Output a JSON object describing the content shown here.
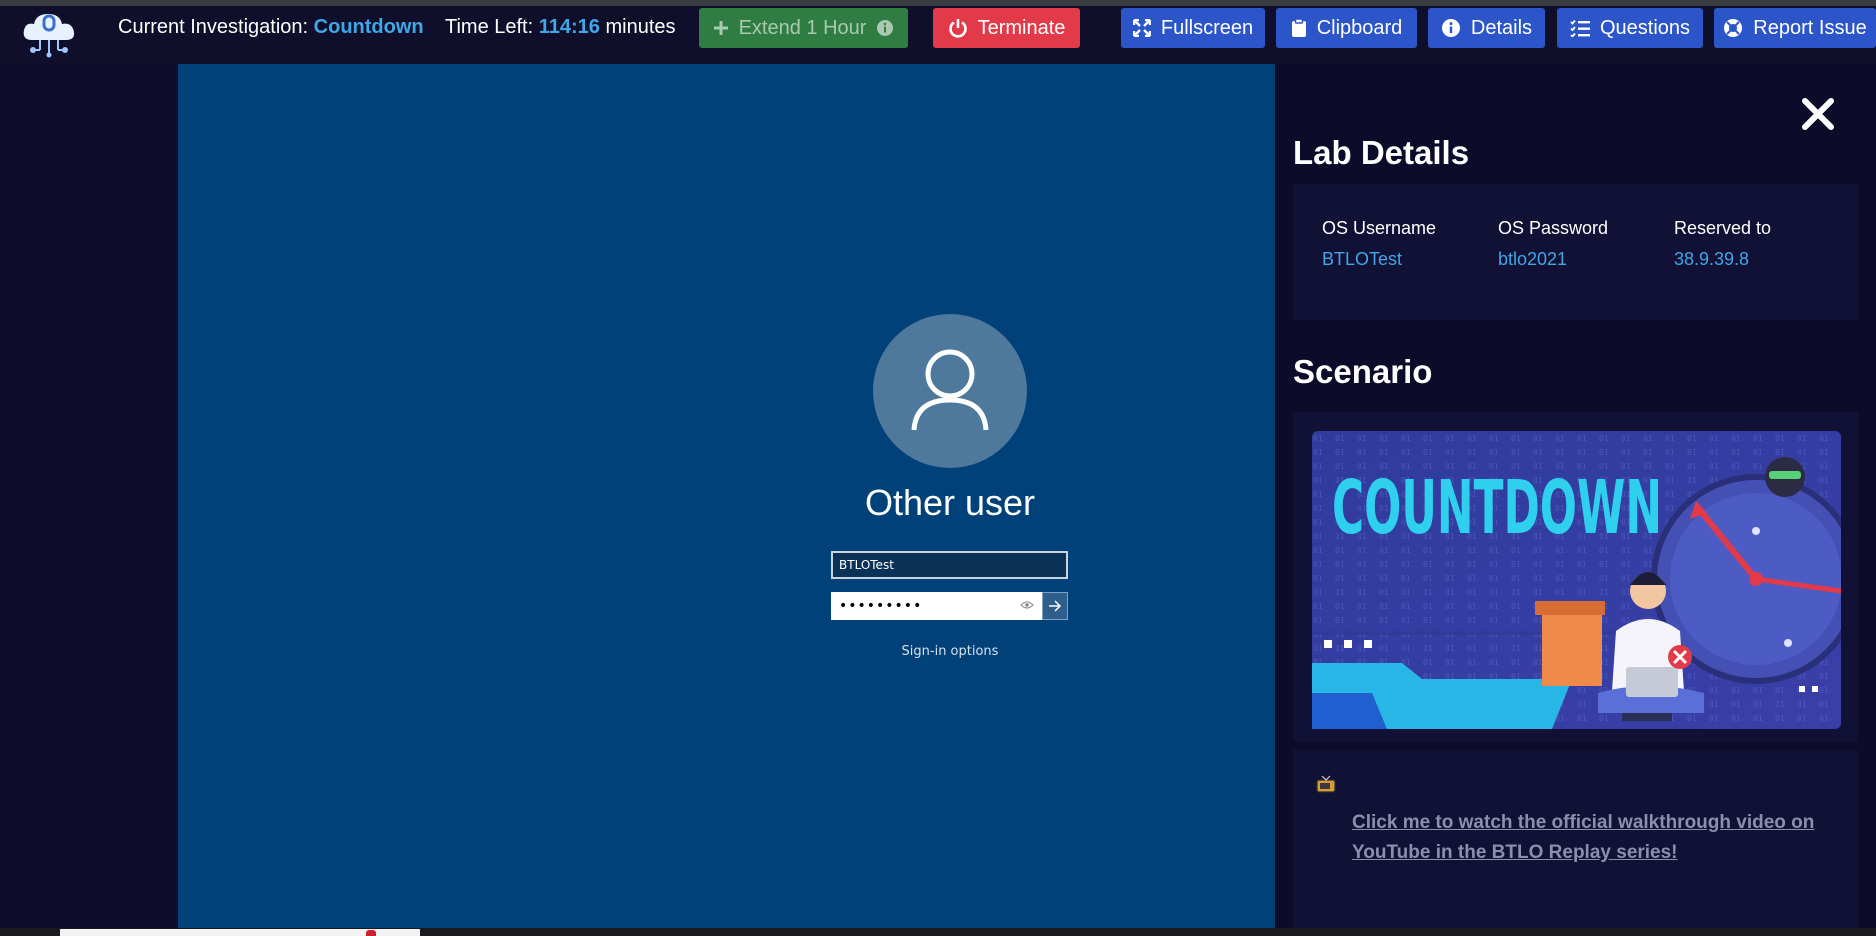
{
  "header": {
    "investigation_label": "Current Investigation:",
    "investigation_name": "Countdown",
    "time_label": "Time Left:",
    "time_value": "114:16",
    "time_unit": "minutes",
    "buttons": {
      "extend": "Extend 1 Hour",
      "terminate": "Terminate",
      "fullscreen": "Fullscreen",
      "clipboard": "Clipboard",
      "details": "Details",
      "questions": "Questions",
      "report": "Report Issue"
    },
    "icons": [
      "plus-icon",
      "info-icon",
      "power-icon",
      "expand-icon",
      "clipboard-icon",
      "info-circle-icon",
      "list-icon",
      "lifebuoy-icon"
    ]
  },
  "desktop": {
    "username": "Other user",
    "username_field": "BTLOTest",
    "password_field": "•••••••••",
    "sign_in_options": "Sign-in options"
  },
  "panel": {
    "lab_details_title": "Lab Details",
    "details": [
      {
        "label": "OS Username",
        "value": "BTLOTest"
      },
      {
        "label": "OS Password",
        "value": "btlo2021"
      },
      {
        "label": "Reserved to",
        "value": "38.9.39.8"
      }
    ],
    "scenario_title": "Scenario",
    "banner_title": "COUNTDOWN",
    "walkthrough_link": "Click me to watch the official walkthrough video on YouTube in the BTLO Replay series!"
  },
  "colors": {
    "accent": "#3fa7e8",
    "terminate": "#e23a48",
    "extend": "#2f7d43",
    "action": "#2b55c8",
    "desktop": "#00417a"
  }
}
